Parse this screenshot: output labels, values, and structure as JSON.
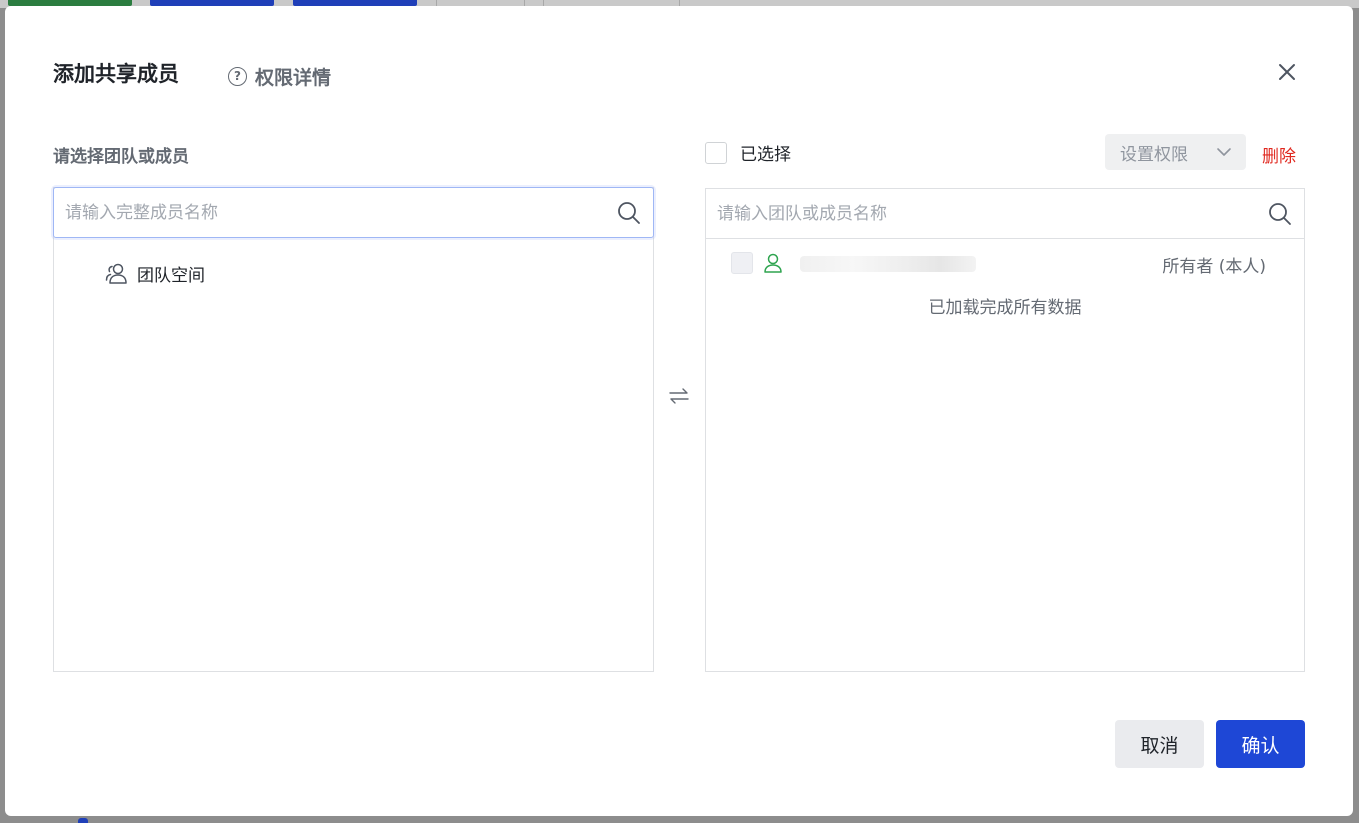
{
  "dialog": {
    "title": "添加共享成员",
    "permission_details_label": "权限详情"
  },
  "left_panel": {
    "label": "请选择团队或成员",
    "search_placeholder": "请输入完整成员名称",
    "items": [
      {
        "label": "团队空间",
        "icon": "team-icon"
      }
    ]
  },
  "right_panel": {
    "select_all_label": "已选择",
    "set_permission_label": "设置权限",
    "delete_label": "删除",
    "search_placeholder": "请输入团队或成员名称",
    "members": [
      {
        "name": "",
        "role": "所有者 (本人)",
        "icon": "user-icon"
      }
    ],
    "loaded_message": "已加载完成所有数据"
  },
  "footer": {
    "cancel_label": "取消",
    "confirm_label": "确认"
  },
  "colors": {
    "primary": "#1e47d6",
    "danger": "#e0281f",
    "user_icon": "#2ea44f"
  }
}
